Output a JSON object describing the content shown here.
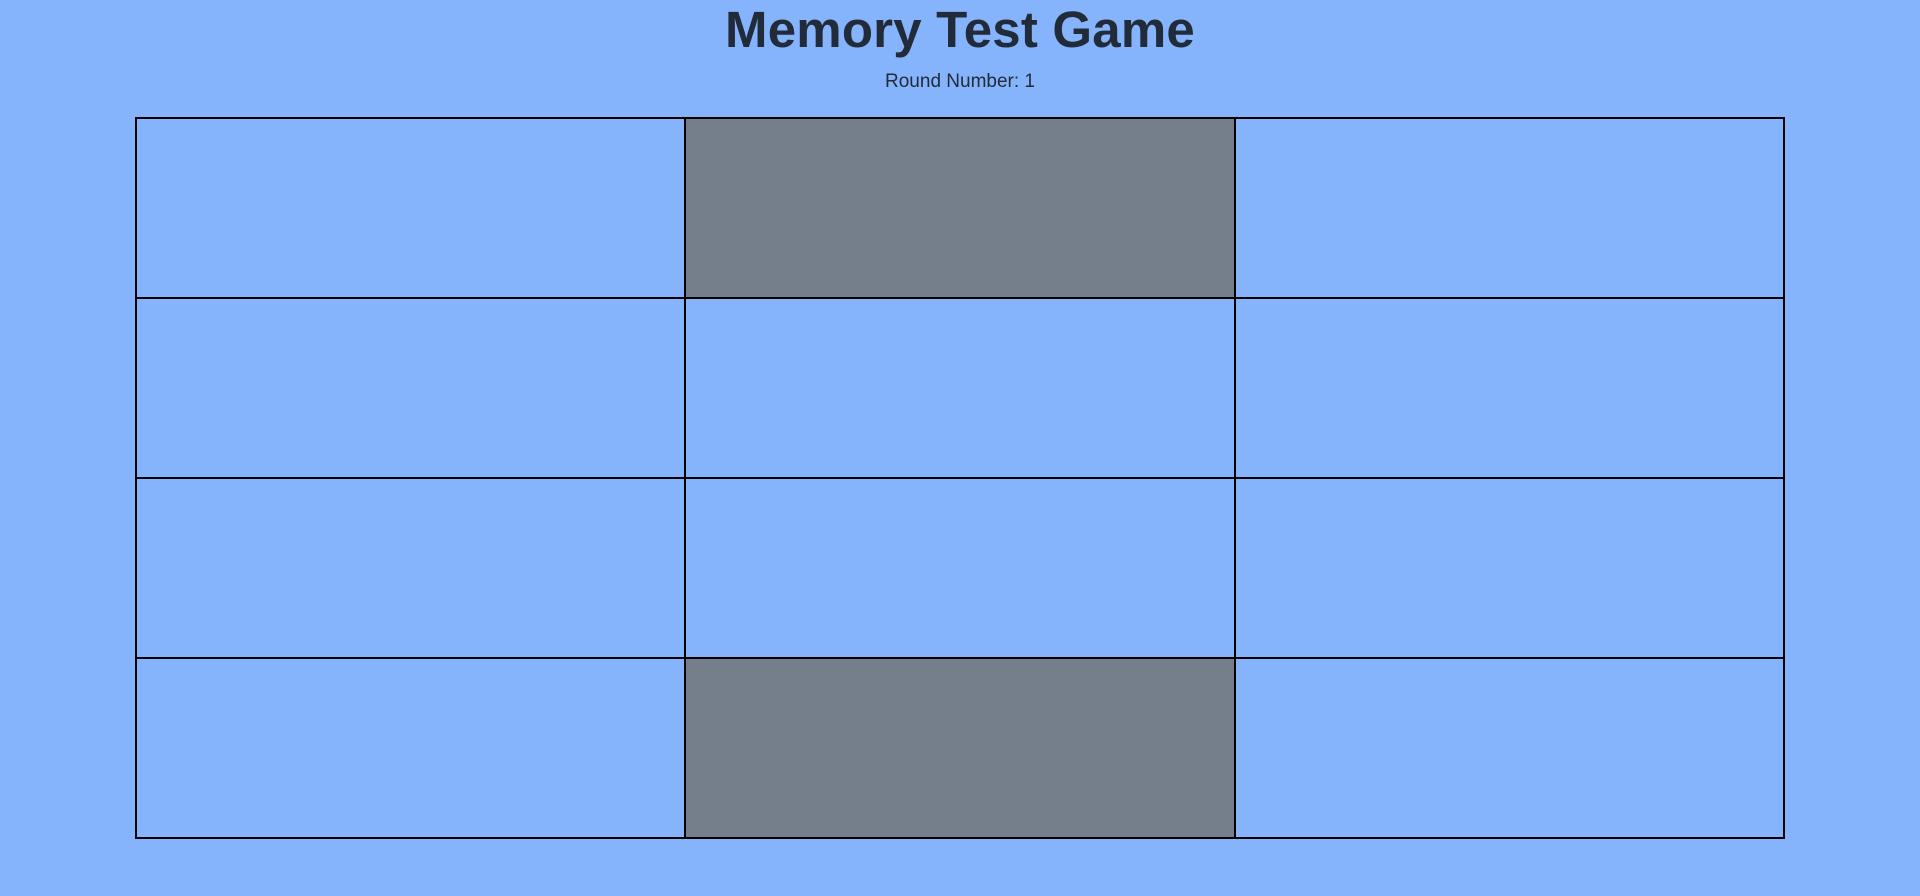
{
  "game": {
    "title": "Memory Test Game",
    "round_label": "Round Number: 1",
    "grid": {
      "rows": 4,
      "cols": 3,
      "tiles": [
        {
          "lit": false
        },
        {
          "lit": true
        },
        {
          "lit": false
        },
        {
          "lit": false
        },
        {
          "lit": false
        },
        {
          "lit": false
        },
        {
          "lit": false
        },
        {
          "lit": false
        },
        {
          "lit": false
        },
        {
          "lit": false
        },
        {
          "lit": true
        },
        {
          "lit": false
        }
      ]
    },
    "colors": {
      "background": "#85b4fc",
      "tile_default": "#85b4fc",
      "tile_lit": "#757f8c",
      "border": "#000000",
      "text": "#222b3a"
    }
  }
}
